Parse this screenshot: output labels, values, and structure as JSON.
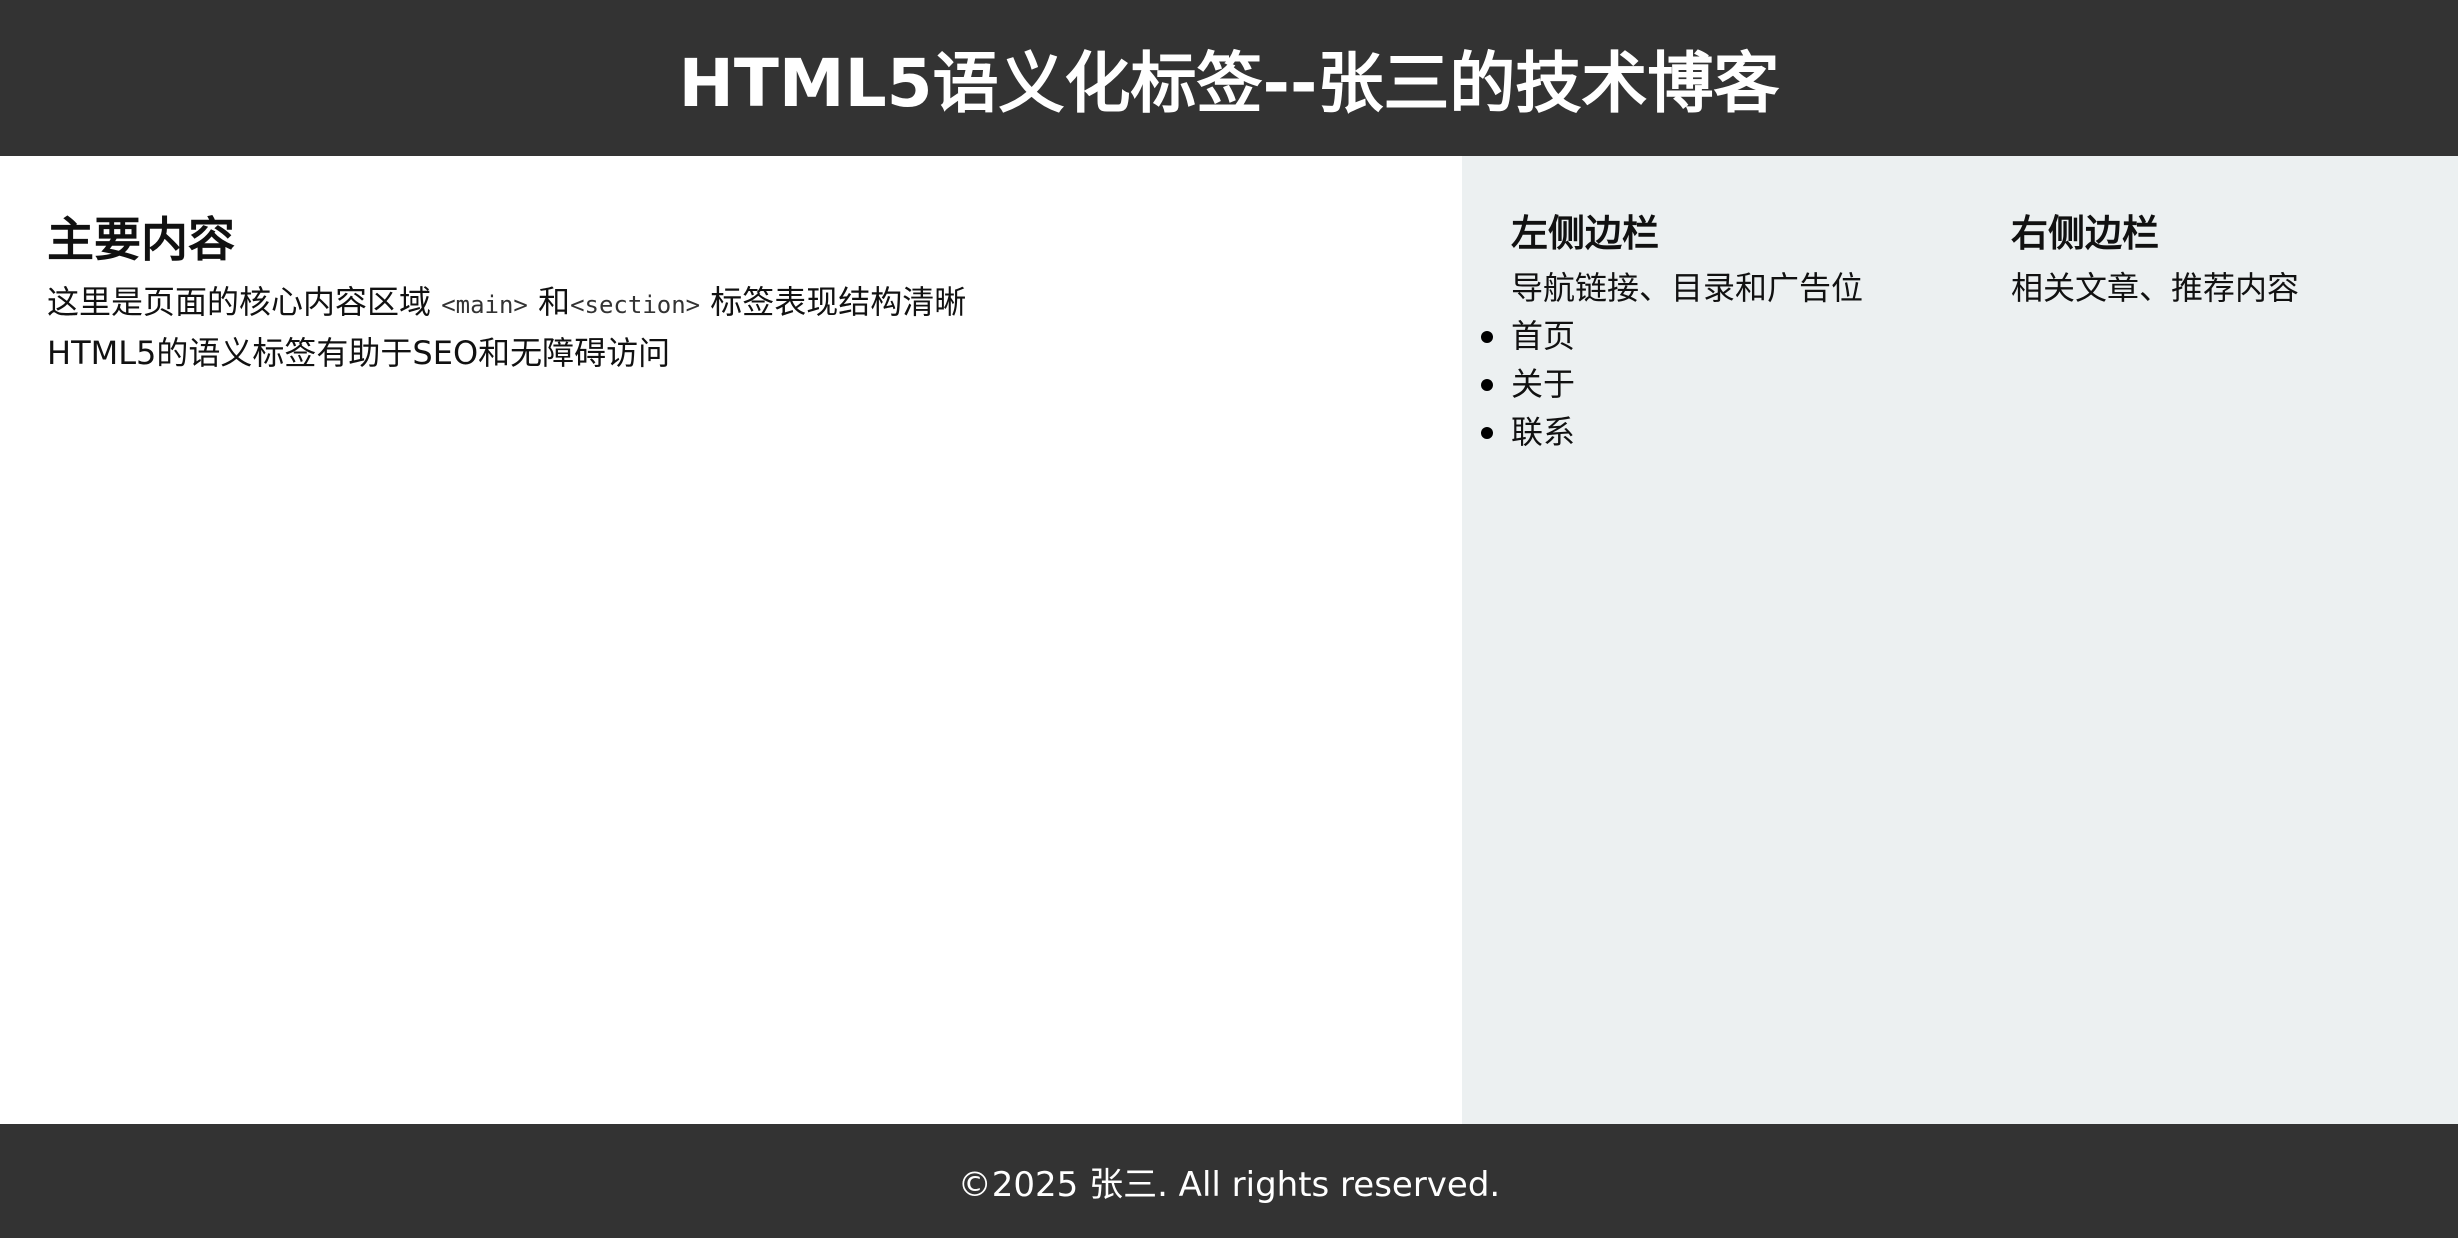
{
  "header": {
    "title": "HTML5语义化标签--张三的技术博客"
  },
  "main": {
    "heading": "主要内容",
    "line1_pre": "这里是页面的核心内容区域 ",
    "line1_code1": "<main>",
    "line1_mid": " 和",
    "line1_code2": "<section>",
    "line1_post": " 标签表现结构清晰",
    "line2": "HTML5的语义标签有助于SEO和无障碍访问"
  },
  "sidebar_left": {
    "heading": "左侧边栏",
    "text": "导航链接、目录和广告位",
    "items": [
      {
        "label": "首页"
      },
      {
        "label": "关于"
      },
      {
        "label": "联系"
      }
    ]
  },
  "sidebar_right": {
    "heading": "右侧边栏",
    "text": "相关文章、推荐内容"
  },
  "footer": {
    "text": "©2025 张三. All rights reserved."
  },
  "colors": {
    "header_bg": "#333333",
    "sidebar_bg": "#ecf0f1",
    "footer_bg": "#333333",
    "header_text": "#ffffff"
  }
}
